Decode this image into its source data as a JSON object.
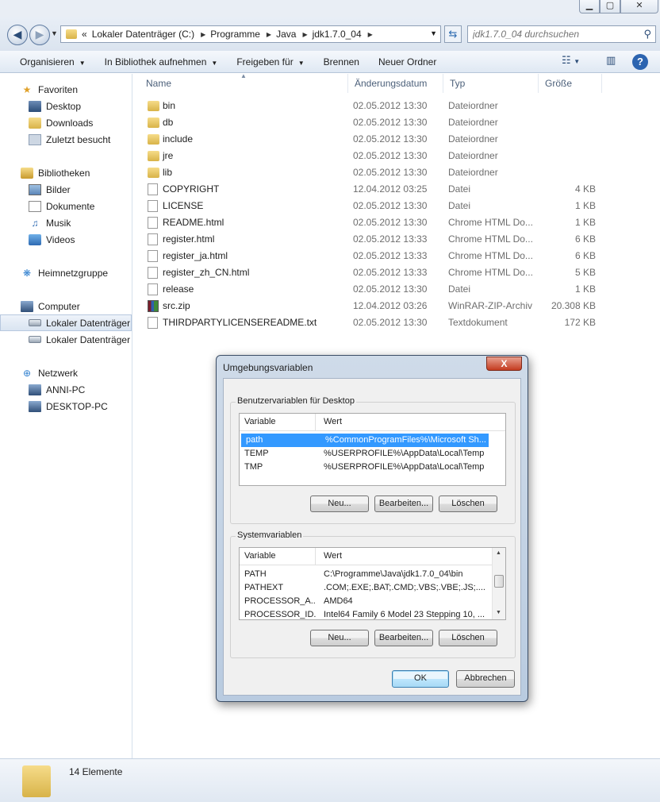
{
  "explorer": {
    "address": {
      "overflow": "«",
      "crumbs": [
        "Lokaler Datenträger (C:)",
        "Programme",
        "Java",
        "jdk1.7.0_04"
      ]
    },
    "search_placeholder": "jdk1.7.0_04 durchsuchen",
    "commands": {
      "organize": "Organisieren",
      "include_library": "In Bibliothek aufnehmen",
      "share": "Freigeben für",
      "burn": "Brennen",
      "new_folder": "Neuer Ordner"
    },
    "nav": {
      "favorites": "Favoriten",
      "desktop": "Desktop",
      "downloads": "Downloads",
      "recent": "Zuletzt besucht",
      "libraries": "Bibliotheken",
      "pictures": "Bilder",
      "documents": "Dokumente",
      "music": "Musik",
      "videos": "Videos",
      "homegroup": "Heimnetzgruppe",
      "computer": "Computer",
      "drive_c": "Lokaler Datenträger",
      "drive_d": "Lokaler Datenträger",
      "network": "Netzwerk",
      "pc1": "ANNI-PC",
      "pc2": "DESKTOP-PC"
    },
    "columns": {
      "name": "Name",
      "date": "Änderungsdatum",
      "type": "Typ",
      "size": "Größe"
    },
    "files": [
      {
        "name": "bin",
        "date": "02.05.2012 13:30",
        "type": "Dateiordner",
        "size": "",
        "icon": "folder"
      },
      {
        "name": "db",
        "date": "02.05.2012 13:30",
        "type": "Dateiordner",
        "size": "",
        "icon": "folder"
      },
      {
        "name": "include",
        "date": "02.05.2012 13:30",
        "type": "Dateiordner",
        "size": "",
        "icon": "folder"
      },
      {
        "name": "jre",
        "date": "02.05.2012 13:30",
        "type": "Dateiordner",
        "size": "",
        "icon": "folder"
      },
      {
        "name": "lib",
        "date": "02.05.2012 13:30",
        "type": "Dateiordner",
        "size": "",
        "icon": "folder"
      },
      {
        "name": "COPYRIGHT",
        "date": "12.04.2012 03:25",
        "type": "Datei",
        "size": "4 KB",
        "icon": "file"
      },
      {
        "name": "LICENSE",
        "date": "02.05.2012 13:30",
        "type": "Datei",
        "size": "1 KB",
        "icon": "file"
      },
      {
        "name": "README.html",
        "date": "02.05.2012 13:30",
        "type": "Chrome HTML Do...",
        "size": "1 KB",
        "icon": "file"
      },
      {
        "name": "register.html",
        "date": "02.05.2012 13:33",
        "type": "Chrome HTML Do...",
        "size": "6 KB",
        "icon": "file"
      },
      {
        "name": "register_ja.html",
        "date": "02.05.2012 13:33",
        "type": "Chrome HTML Do...",
        "size": "6 KB",
        "icon": "file"
      },
      {
        "name": "register_zh_CN.html",
        "date": "02.05.2012 13:33",
        "type": "Chrome HTML Do...",
        "size": "5 KB",
        "icon": "file"
      },
      {
        "name": "release",
        "date": "02.05.2012 13:30",
        "type": "Datei",
        "size": "1 KB",
        "icon": "file"
      },
      {
        "name": "src.zip",
        "date": "12.04.2012 03:26",
        "type": "WinRAR-ZIP-Archiv",
        "size": "20.308 KB",
        "icon": "zip"
      },
      {
        "name": "THIRDPARTYLICENSEREADME.txt",
        "date": "02.05.2012 13:30",
        "type": "Textdokument",
        "size": "172 KB",
        "icon": "file"
      }
    ],
    "status": "14 Elemente"
  },
  "dialog": {
    "title": "Umgebungsvariablen",
    "close": "X",
    "user_group": "Benutzervariablen für Desktop",
    "system_group": "Systemvariablen",
    "col_variable": "Variable",
    "col_value": "Wert",
    "user_vars": [
      {
        "name": "path",
        "value": "%CommonProgramFiles%\\Microsoft Sh...",
        "selected": true
      },
      {
        "name": "TEMP",
        "value": "%USERPROFILE%\\AppData\\Local\\Temp",
        "selected": false
      },
      {
        "name": "TMP",
        "value": "%USERPROFILE%\\AppData\\Local\\Temp",
        "selected": false
      }
    ],
    "system_vars": [
      {
        "name": "PATH",
        "value": "C:\\Programme\\Java\\jdk1.7.0_04\\bin"
      },
      {
        "name": "PATHEXT",
        "value": ".COM;.EXE;.BAT;.CMD;.VBS;.VBE;.JS;...."
      },
      {
        "name": "PROCESSOR_A...",
        "value": "AMD64"
      },
      {
        "name": "PROCESSOR_ID...",
        "value": "Intel64 Family 6 Model 23 Stepping 10, ..."
      }
    ],
    "buttons": {
      "new": "Neu...",
      "edit": "Bearbeiten...",
      "delete": "Löschen",
      "ok": "OK",
      "cancel": "Abbrechen"
    }
  },
  "colors": {
    "selection": "#3399ff",
    "chrome": "#dbe4ef"
  }
}
